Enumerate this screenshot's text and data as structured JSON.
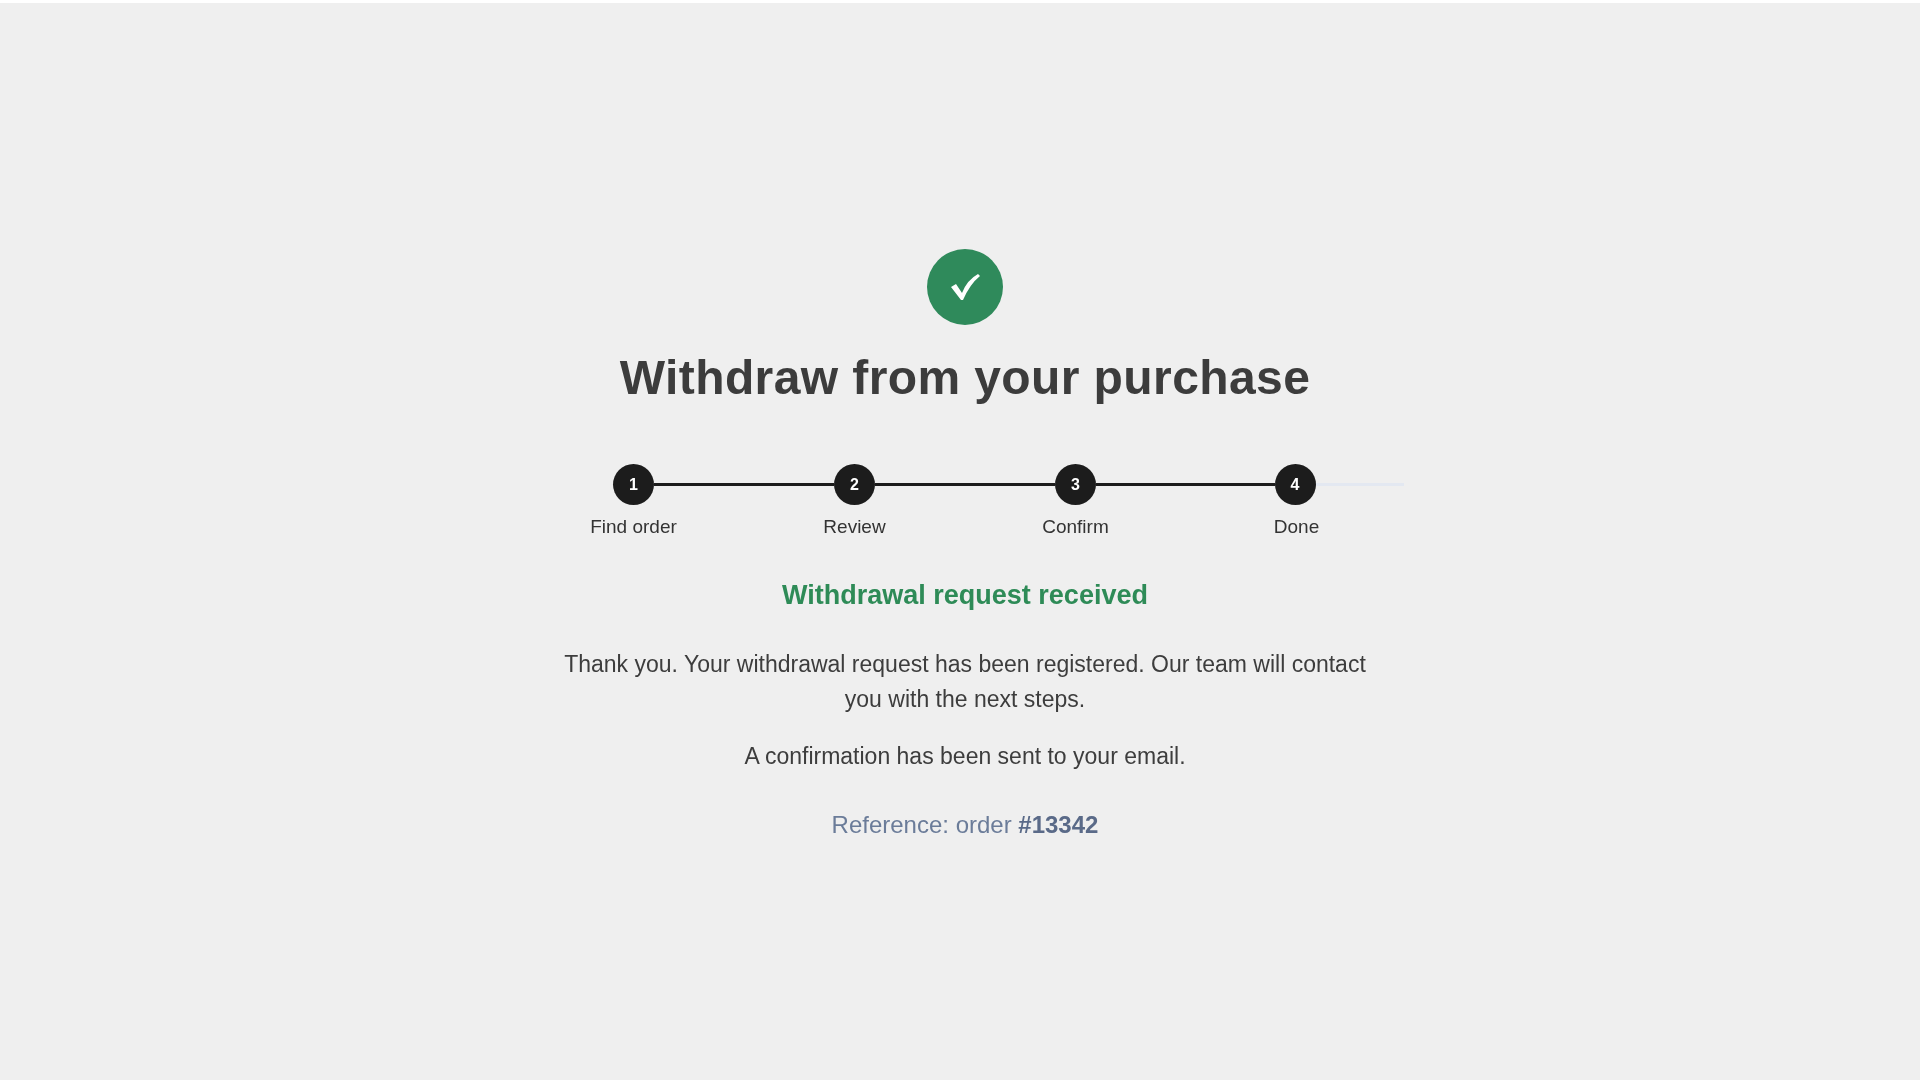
{
  "title": "Withdraw from your purchase",
  "stepper": {
    "steps": [
      {
        "number": "1",
        "label": "Find order",
        "completed": true
      },
      {
        "number": "2",
        "label": "Review",
        "completed": true
      },
      {
        "number": "3",
        "label": "Confirm",
        "completed": true
      },
      {
        "number": "4",
        "label": "Done",
        "completed": true
      }
    ]
  },
  "result": {
    "heading": "Withdrawal request received",
    "message": "Thank you. Your withdrawal request has been registered. Our team will contact you with the next steps.",
    "note": "A confirmation has been sent to your email.",
    "reference": "Reference: order **#13342**"
  }
}
